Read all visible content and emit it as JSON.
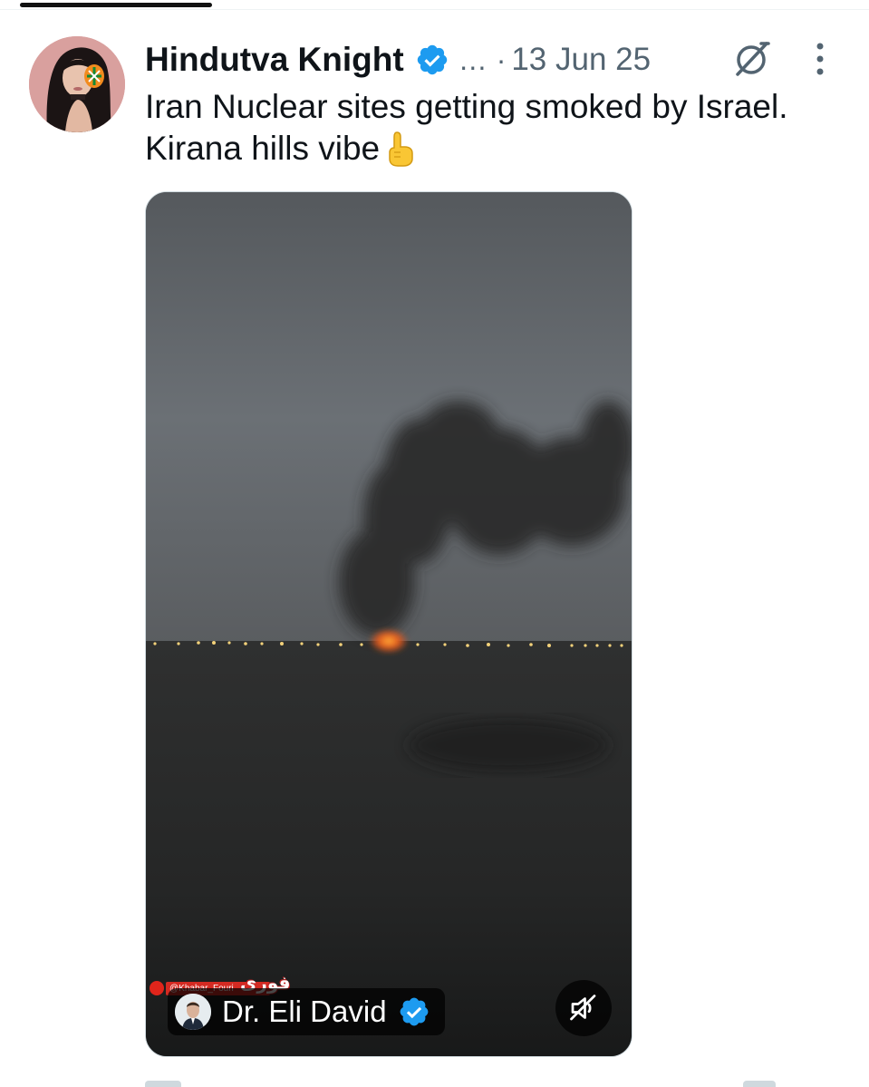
{
  "tweet": {
    "display_name": "Hindutva Knight",
    "ellipsis": "…",
    "separator": "·",
    "timestamp": "13 Jun 25",
    "text": "Iran Nuclear sites getting smoked by Israel. Kirana hills vibe",
    "emoji": "backhand-index-pointing-up",
    "verified": true
  },
  "media": {
    "type": "video",
    "watermark_handle": "@Khabar_Fouri",
    "source_name": "Dr. Eli David",
    "source_verified": true,
    "muted": true
  },
  "colors": {
    "verified_blue": "#1d9bf0",
    "text_primary": "#0f1419",
    "text_secondary": "#536471"
  },
  "icons": {
    "grok": "grok-icon",
    "more": "more-vertical-icon",
    "mute": "speaker-muted-icon"
  }
}
